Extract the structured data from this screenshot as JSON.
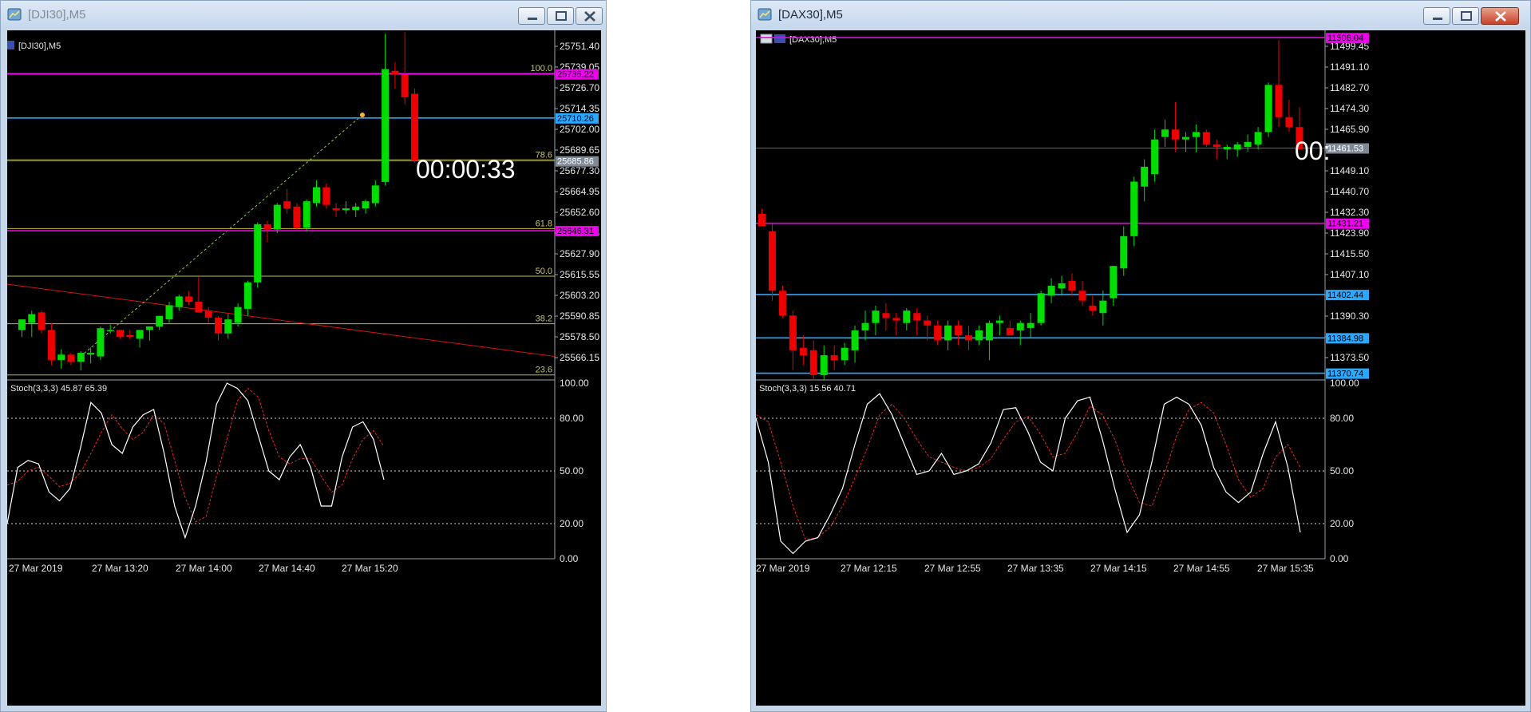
{
  "colors": {
    "bull": "#00dd00",
    "bear": "#ee0000",
    "magenta": "#ee00ee",
    "blue": "#2aa8ff",
    "fib": "#bdbd4a",
    "stoch_main": "#ffffff",
    "stoch_signal": "#ee2222",
    "trend": "#d81010",
    "fib_diag": "#88cc44",
    "gray_price": "#808a96"
  },
  "windows": [
    {
      "id": "dji",
      "title": "[DJI30],M5",
      "chart_label": "[DJI30],M5",
      "active": false,
      "countdown": "00:00:33",
      "stoch_label": "Stoch(3,3,3) 45.87 65.39",
      "price_axis": [
        "25751.40",
        "25739.05",
        "25726.70",
        "25714.35",
        "25702.00",
        "25689.65",
        "25677.30",
        "25664.95",
        "25652.60",
        "25640.25",
        "25627.90",
        "25615.55",
        "25603.20",
        "25590.85",
        "25578.50",
        "25566.15"
      ],
      "stoch_axis": [
        "100.00",
        "80.00",
        "50.00",
        "20.00",
        "0.00"
      ],
      "time_axis": [
        "27 Mar 2019",
        "27 Mar 13:20",
        "27 Mar 14:00",
        "27 Mar 14:40",
        "27 Mar 15:20"
      ],
      "price_range": [
        25563.0,
        25760.0
      ],
      "fib_levels": [
        {
          "label": "100.0",
          "price": 25735.5
        },
        {
          "label": "78.6",
          "price": 25686.5
        },
        {
          "label": "61.8",
          "price": 25647.5
        },
        {
          "label": "50.0",
          "price": 25620.5
        },
        {
          "label": "38.2",
          "price": 25593.5
        },
        {
          "label": "23.6",
          "price": 25564.5
        }
      ],
      "price_lines": [
        {
          "price": 25735.22,
          "label": "25735.22",
          "color": "#ee00ee"
        },
        {
          "price": 25710.26,
          "label": "25710.26",
          "color": "#2aa8ff"
        },
        {
          "price": 25646.31,
          "label": "25646.31",
          "color": "#ee00ee"
        },
        {
          "price": 25685.86,
          "label": "25685.86",
          "color": "#808a96"
        }
      ],
      "candles": [
        [
          25590,
          25596,
          25586,
          25596
        ],
        [
          25594,
          25601,
          25586,
          25599
        ],
        [
          25600,
          25601,
          25588,
          25590
        ],
        [
          25590,
          25594,
          25570,
          25573
        ],
        [
          25573,
          25579,
          25568,
          25576
        ],
        [
          25576,
          25577,
          25570,
          25572
        ],
        [
          25572,
          25578,
          25567,
          25577
        ],
        [
          25576,
          25580,
          25571,
          25577
        ],
        [
          25575,
          25592,
          25573,
          25591
        ],
        [
          25590,
          25593,
          25588,
          25590
        ],
        [
          25590,
          25590,
          25585,
          25586
        ],
        [
          25587,
          25590,
          25585,
          25586
        ],
        [
          25585,
          25590,
          25580,
          25590
        ],
        [
          25590,
          25592,
          25584,
          25592
        ],
        [
          25592,
          25598,
          25590,
          25598
        ],
        [
          25596,
          25606,
          25594,
          25604
        ],
        [
          25603,
          25610,
          25601,
          25609
        ],
        [
          25609,
          25612,
          25604,
          25606
        ],
        [
          25606,
          25620,
          25602,
          25600
        ],
        [
          25601,
          25603,
          25594,
          25597
        ],
        [
          25597,
          25598,
          25584,
          25588
        ],
        [
          25588,
          25599,
          25585,
          25596
        ],
        [
          25594,
          25605,
          25592,
          25603
        ],
        [
          25602,
          25618,
          25598,
          25617
        ],
        [
          25617,
          25651,
          25614,
          25650
        ],
        [
          25650,
          25652,
          25640,
          25647
        ],
        [
          25647,
          25662,
          25645,
          25661
        ],
        [
          25663,
          25670,
          25656,
          25659
        ],
        [
          25660,
          25662,
          25646,
          25648
        ],
        [
          25648,
          25664,
          25646,
          25663
        ],
        [
          25662,
          25675,
          25660,
          25671
        ],
        [
          25671,
          25673,
          25659,
          25661
        ],
        [
          25659,
          25662,
          25654,
          25658
        ],
        [
          25658,
          25663,
          25656,
          25659
        ],
        [
          25658,
          25662,
          25654,
          25660
        ],
        [
          25659,
          25664,
          25656,
          25663
        ],
        [
          25662,
          25675,
          25660,
          25672
        ],
        [
          25674,
          25758,
          25672,
          25738
        ],
        [
          25737,
          25742,
          25727,
          25735
        ],
        [
          25735,
          25759,
          25718,
          25722
        ],
        [
          25724,
          25727,
          25685,
          25686
        ]
      ],
      "stoch_main": [
        20,
        52,
        56,
        54,
        38,
        33,
        40,
        63,
        89,
        83,
        65,
        60,
        75,
        82,
        85,
        60,
        30,
        12,
        30,
        55,
        88,
        100,
        97,
        90,
        70,
        50,
        45,
        58,
        65,
        52,
        30,
        30,
        58,
        75,
        78,
        68,
        45
      ],
      "stoch_signal": [
        42,
        44,
        50,
        52,
        47,
        41,
        43,
        49,
        60,
        72,
        82,
        74,
        68,
        72,
        82,
        77,
        56,
        35,
        21,
        24,
        47,
        68,
        90,
        97,
        92,
        73,
        58,
        54,
        57,
        57,
        47,
        38,
        42,
        57,
        68,
        73,
        64
      ]
    },
    {
      "id": "dax",
      "title": "[DAX30],M5",
      "chart_label": "[DAX30],M5",
      "active": true,
      "countdown": "00:",
      "stoch_label": "Stoch(3,3,3) 15.56 40.71",
      "price_axis": [
        "11499.45",
        "11491.10",
        "11482.70",
        "11474.30",
        "11465.90",
        "11457.50",
        "11449.10",
        "11440.70",
        "11432.30",
        "11423.90",
        "11415.50",
        "11407.10",
        "11398.70",
        "11390.30",
        "11381.90",
        "11373.50"
      ],
      "stoch_axis": [
        "100.00",
        "80.00",
        "50.00",
        "20.00",
        "0.00"
      ],
      "time_axis": [
        "27 Mar 2019",
        "27 Mar 12:15",
        "27 Mar 12:55",
        "27 Mar 13:35",
        "27 Mar 14:15",
        "27 Mar 14:55",
        "27 Mar 15:35"
      ],
      "price_range": [
        11369.0,
        11509.0
      ],
      "fib_levels": [],
      "price_lines": [
        {
          "price": 11506.04,
          "label": "11506.04",
          "color": "#ee00ee"
        },
        {
          "price": 11461.53,
          "label": "11461.53",
          "color": "#808a96"
        },
        {
          "price": 11431.21,
          "label": "11431.21",
          "color": "#ee00ee"
        },
        {
          "price": 11402.44,
          "label": "11402.44",
          "color": "#2aa8ff"
        },
        {
          "price": 11384.98,
          "label": "11384.98",
          "color": "#2aa8ff"
        },
        {
          "price": 11370.74,
          "label": "11370.74",
          "color": "#2aa8ff"
        }
      ],
      "candles": [
        [
          11435,
          11437,
          11430,
          11430
        ],
        [
          11428,
          11431,
          11400,
          11404
        ],
        [
          11404,
          11406,
          11393,
          11394
        ],
        [
          11394,
          11396,
          11372,
          11380
        ],
        [
          11381,
          11386,
          11374,
          11378
        ],
        [
          11380,
          11384,
          11368,
          11370
        ],
        [
          11370,
          11382,
          11368,
          11378
        ],
        [
          11378,
          11382,
          11372,
          11376
        ],
        [
          11376,
          11383,
          11374,
          11381
        ],
        [
          11380,
          11390,
          11375,
          11388
        ],
        [
          11388,
          11396,
          11384,
          11391
        ],
        [
          11391,
          11398,
          11386,
          11396
        ],
        [
          11395,
          11399,
          11388,
          11393
        ],
        [
          11393,
          11395,
          11386,
          11392
        ],
        [
          11391,
          11397,
          11388,
          11396
        ],
        [
          11395,
          11397,
          11386,
          11392
        ],
        [
          11392,
          11394,
          11384,
          11390
        ],
        [
          11390,
          11392,
          11382,
          11384
        ],
        [
          11384,
          11392,
          11380,
          11390
        ],
        [
          11390,
          11392,
          11382,
          11386
        ],
        [
          11386,
          11390,
          11380,
          11384
        ],
        [
          11384,
          11390,
          11382,
          11388
        ],
        [
          11384,
          11392,
          11376,
          11391
        ],
        [
          11391,
          11394,
          11386,
          11392
        ],
        [
          11389,
          11392,
          11386,
          11386
        ],
        [
          11388,
          11392,
          11382,
          11391
        ],
        [
          11389,
          11395,
          11385,
          11391
        ],
        [
          11391,
          11404,
          11390,
          11403
        ],
        [
          11402,
          11409,
          11399,
          11406
        ],
        [
          11405,
          11410,
          11402,
          11407
        ],
        [
          11408,
          11411,
          11402,
          11404
        ],
        [
          11404,
          11408,
          11398,
          11400
        ],
        [
          11398,
          11402,
          11394,
          11396
        ],
        [
          11395,
          11404,
          11390,
          11400
        ],
        [
          11401,
          11414,
          11398,
          11414
        ],
        [
          11413,
          11430,
          11410,
          11426
        ],
        [
          11426,
          11450,
          11422,
          11448
        ],
        [
          11446,
          11457,
          11440,
          11454
        ],
        [
          11451,
          11469,
          11448,
          11465
        ],
        [
          11466,
          11473,
          11462,
          11469
        ],
        [
          11469,
          11480,
          11460,
          11465
        ],
        [
          11465,
          11468,
          11460,
          11466
        ],
        [
          11466,
          11471,
          11460,
          11468
        ],
        [
          11468,
          11469,
          11462,
          11463
        ],
        [
          11463,
          11465,
          11457,
          11462
        ],
        [
          11461,
          11463,
          11457,
          11462
        ],
        [
          11461,
          11464,
          11458,
          11463
        ],
        [
          11462,
          11467,
          11460,
          11464
        ],
        [
          11463,
          11470,
          11461,
          11468
        ],
        [
          11468,
          11488,
          11466,
          11487
        ],
        [
          11487,
          11505,
          11470,
          11474
        ],
        [
          11474,
          11481,
          11468,
          11470
        ],
        [
          11470,
          11478,
          11461,
          11461
        ]
      ],
      "stoch_main": [
        80,
        55,
        10,
        3,
        10,
        12,
        25,
        40,
        65,
        88,
        94,
        82,
        65,
        48,
        50,
        60,
        48,
        50,
        54,
        66,
        85,
        86,
        72,
        55,
        50,
        80,
        90,
        92,
        68,
        40,
        15,
        25,
        55,
        88,
        92,
        88,
        76,
        52,
        38,
        32,
        38,
        60,
        78,
        52,
        15
      ],
      "stoch_signal": [
        82,
        78,
        55,
        30,
        11,
        12,
        18,
        30,
        46,
        63,
        82,
        88,
        80,
        68,
        58,
        55,
        52,
        50,
        52,
        57,
        68,
        78,
        81,
        71,
        58,
        60,
        72,
        87,
        82,
        68,
        48,
        32,
        30,
        48,
        70,
        85,
        89,
        83,
        65,
        45,
        35,
        40,
        58,
        65,
        52
      ]
    }
  ]
}
